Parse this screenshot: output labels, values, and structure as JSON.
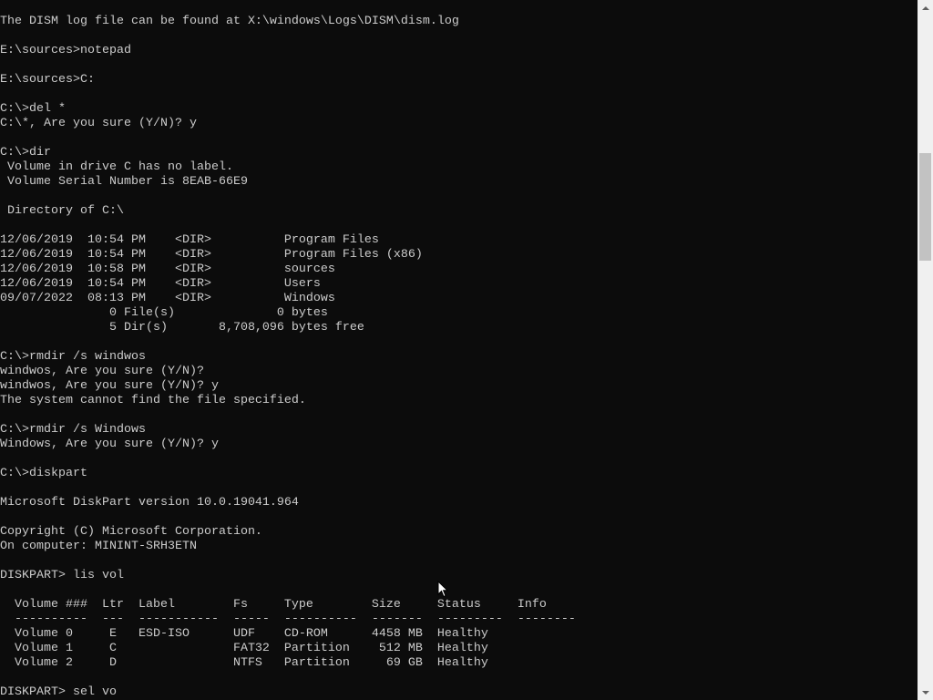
{
  "console": {
    "lines": [
      "The DISM log file can be found at X:\\windows\\Logs\\DISM\\dism.log",
      "",
      "E:\\sources>notepad",
      "",
      "E:\\sources>C:",
      "",
      "C:\\>del *",
      "C:\\*, Are you sure (Y/N)? y",
      "",
      "C:\\>dir",
      " Volume in drive C has no label.",
      " Volume Serial Number is 8EAB-66E9",
      "",
      " Directory of C:\\",
      "",
      "12/06/2019  10:54 PM    <DIR>          Program Files",
      "12/06/2019  10:54 PM    <DIR>          Program Files (x86)",
      "12/06/2019  10:58 PM    <DIR>          sources",
      "12/06/2019  10:54 PM    <DIR>          Users",
      "09/07/2022  08:13 PM    <DIR>          Windows",
      "               0 File(s)              0 bytes",
      "               5 Dir(s)       8,708,096 bytes free",
      "",
      "C:\\>rmdir /s windwos",
      "windwos, Are you sure (Y/N)?",
      "windwos, Are you sure (Y/N)? y",
      "The system cannot find the file specified.",
      "",
      "C:\\>rmdir /s Windows",
      "Windows, Are you sure (Y/N)? y",
      "",
      "C:\\>diskpart",
      "",
      "Microsoft DiskPart version 10.0.19041.964",
      "",
      "Copyright (C) Microsoft Corporation.",
      "On computer: MININT-SRH3ETN",
      "",
      "DISKPART> lis vol",
      "",
      "  Volume ###  Ltr  Label        Fs     Type        Size     Status     Info",
      "  ----------  ---  -----------  -----  ----------  -------  ---------  --------",
      "  Volume 0     E   ESD-ISO      UDF    CD-ROM      4458 MB  Healthy",
      "  Volume 1     C                FAT32  Partition    512 MB  Healthy",
      "  Volume 2     D                NTFS   Partition     69 GB  Healthy",
      "",
      "DISKPART> sel vo"
    ]
  },
  "scrollbar": {
    "up_icon": "arrow-up-icon",
    "down_icon": "arrow-down-icon"
  },
  "colors": {
    "background": "#0c0c0c",
    "text": "#cccccc",
    "scrollbar_track": "#f0f0f0",
    "scrollbar_thumb": "#c2c2c2"
  }
}
